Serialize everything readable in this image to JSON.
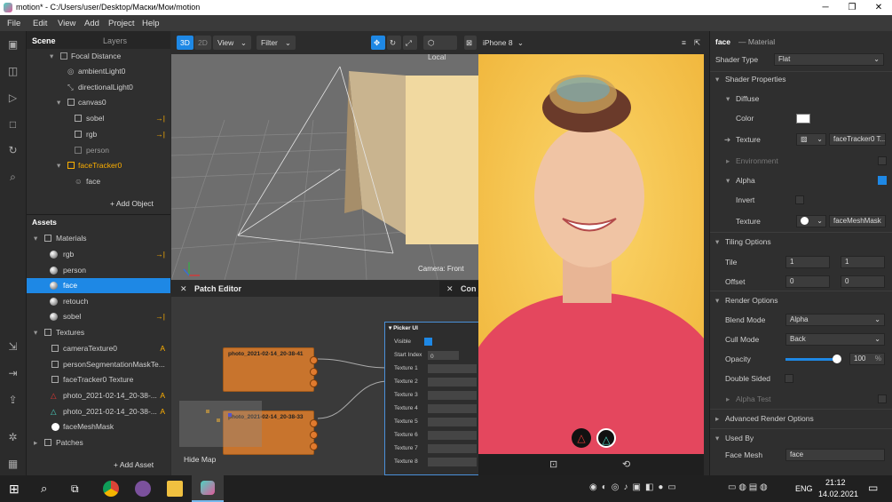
{
  "window": {
    "title": "motion* - C:/Users/user/Desktop/Маски/Мои/motion"
  },
  "menu": [
    "File",
    "Edit",
    "View",
    "Add",
    "Project",
    "Help"
  ],
  "scene_panel": {
    "tabs": [
      "Scene",
      "Layers"
    ],
    "items": [
      {
        "label": "Focal Distance",
        "icon": "folder-icon"
      },
      {
        "label": "ambientLight0",
        "icon": "ambient-light-icon"
      },
      {
        "label": "directionalLight0",
        "icon": "directional-light-icon"
      },
      {
        "label": "canvas0",
        "icon": "canvas-icon"
      },
      {
        "label": "sobel",
        "icon": "rectangle-icon",
        "arrow": "→|"
      },
      {
        "label": "rgb",
        "icon": "rectangle-icon",
        "arrow": "→|"
      },
      {
        "label": "person",
        "icon": "rectangle-icon"
      },
      {
        "label": "faceTracker0",
        "icon": "face-tracker-icon"
      },
      {
        "label": "face",
        "icon": "face-mesh-icon"
      }
    ],
    "add_object": "+ Add Object"
  },
  "assets_panel": {
    "title": "Assets",
    "materials_label": "Materials",
    "materials": [
      {
        "label": "rgb",
        "arrow": "→|"
      },
      {
        "label": "person",
        "arrow": ""
      },
      {
        "label": "face",
        "arrow": ""
      },
      {
        "label": "retouch",
        "arrow": ""
      },
      {
        "label": "sobel",
        "arrow": "→|"
      }
    ],
    "textures_label": "Textures",
    "textures": [
      {
        "label": "cameraTexture0",
        "badge": "A"
      },
      {
        "label": "personSegmentationMaskTe...",
        "badge": ""
      },
      {
        "label": "faceTracker0 Texture",
        "badge": ""
      },
      {
        "label": "photo_2021-02-14_20-38-...",
        "badge": "A"
      },
      {
        "label": "photo_2021-02-14_20-38-...",
        "badge": "A"
      },
      {
        "label": "faceMeshMask",
        "badge": ""
      }
    ],
    "patches_label": "Patches",
    "add_asset": "+ Add Asset"
  },
  "viewport": {
    "mode_3d": "3D",
    "mode_2d": "2D",
    "view": "View",
    "filter": "Filter",
    "local": "Local",
    "device": "iPhone 8",
    "camera_label": "Camera: Front"
  },
  "patch_editor": {
    "title": "Patch Editor",
    "second_tab": "Con",
    "node1": "photo_2021-02-14_20-38-41",
    "node2": "photo_2021-02-14_20-38-33",
    "picker": {
      "title": "Picker UI",
      "visible": "Visible",
      "start_index": "Start Index",
      "start_value": "0",
      "textures": [
        "Texture 1",
        "Texture 2",
        "Texture 3",
        "Texture 4",
        "Texture 5",
        "Texture 6",
        "Texture 7",
        "Texture 8"
      ]
    },
    "hide_map": "Hide Map"
  },
  "inspector": {
    "object": "face",
    "object_type": "— Material",
    "shader_type_label": "Shader Type",
    "shader_type_value": "Flat",
    "shader_properties": "Shader Properties",
    "diffuse": "Diffuse",
    "color": "Color",
    "texture": "Texture",
    "texture_value": "faceTracker0 T...",
    "environment": "Environment",
    "alpha": "Alpha",
    "invert": "Invert",
    "alpha_texture": "Texture",
    "alpha_texture_value": "faceMeshMask",
    "tiling_options": "Tiling Options",
    "tile": "Tile",
    "tile_x": "1",
    "tile_y": "1",
    "offset": "Offset",
    "offset_x": "0",
    "offset_y": "0",
    "render_options": "Render Options",
    "blend_mode": "Blend Mode",
    "blend_mode_value": "Alpha",
    "cull_mode": "Cull Mode",
    "cull_mode_value": "Back",
    "opacity": "Opacity",
    "opacity_value": "100",
    "opacity_unit": "%",
    "double_sided": "Double Sided",
    "alpha_test": "Alpha Test",
    "advanced_render": "Advanced Render Options",
    "used_by": "Used By",
    "face_mesh": "Face Mesh",
    "face_mesh_value": "face"
  },
  "taskbar": {
    "lang": "ENG",
    "time": "21:12",
    "date": "14.02.2021"
  },
  "colors": {
    "accent": "#1e88e5",
    "node": "#c8742d",
    "preview_bg": "#f6c24a",
    "face_arrow": "#ffb000"
  }
}
